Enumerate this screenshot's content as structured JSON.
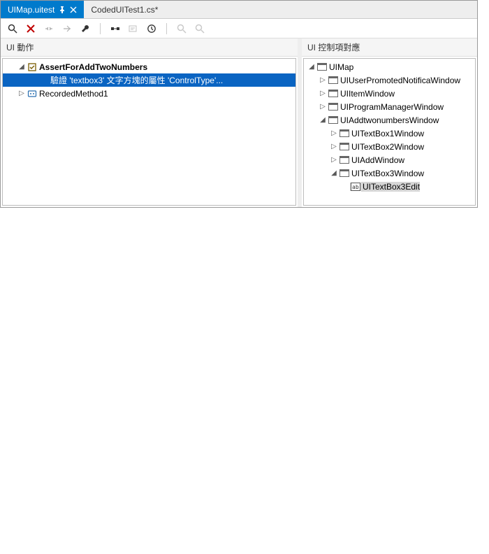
{
  "tabs": [
    {
      "label": "UIMap.uitest",
      "active": true,
      "pinned": true,
      "closable": true
    },
    {
      "label": "CodedUITest1.cs*",
      "active": false
    }
  ],
  "panes": {
    "left_header": "UI 動作",
    "right_header": "UI 控制項對應"
  },
  "left_tree": {
    "assert_root": "AssertForAddTwoNumbers",
    "assert_child": "驗證 'textbox3' 文字方塊的屬性 'ControlType'...",
    "recorded": "RecordedMethod1"
  },
  "right_tree": {
    "root": "UIMap",
    "n1": "UIUserPromotedNotificaWindow",
    "n2": "UIItemWindow",
    "n3": "UIProgramManagerWindow",
    "n4": "UIAddtwonumbersWindow",
    "n4a": "UITextBox1Window",
    "n4b": "UITextBox2Window",
    "n4c": "UIAddWindow",
    "n4d": "UITextBox3Window",
    "n4d1": "UITextBox3Edit"
  }
}
